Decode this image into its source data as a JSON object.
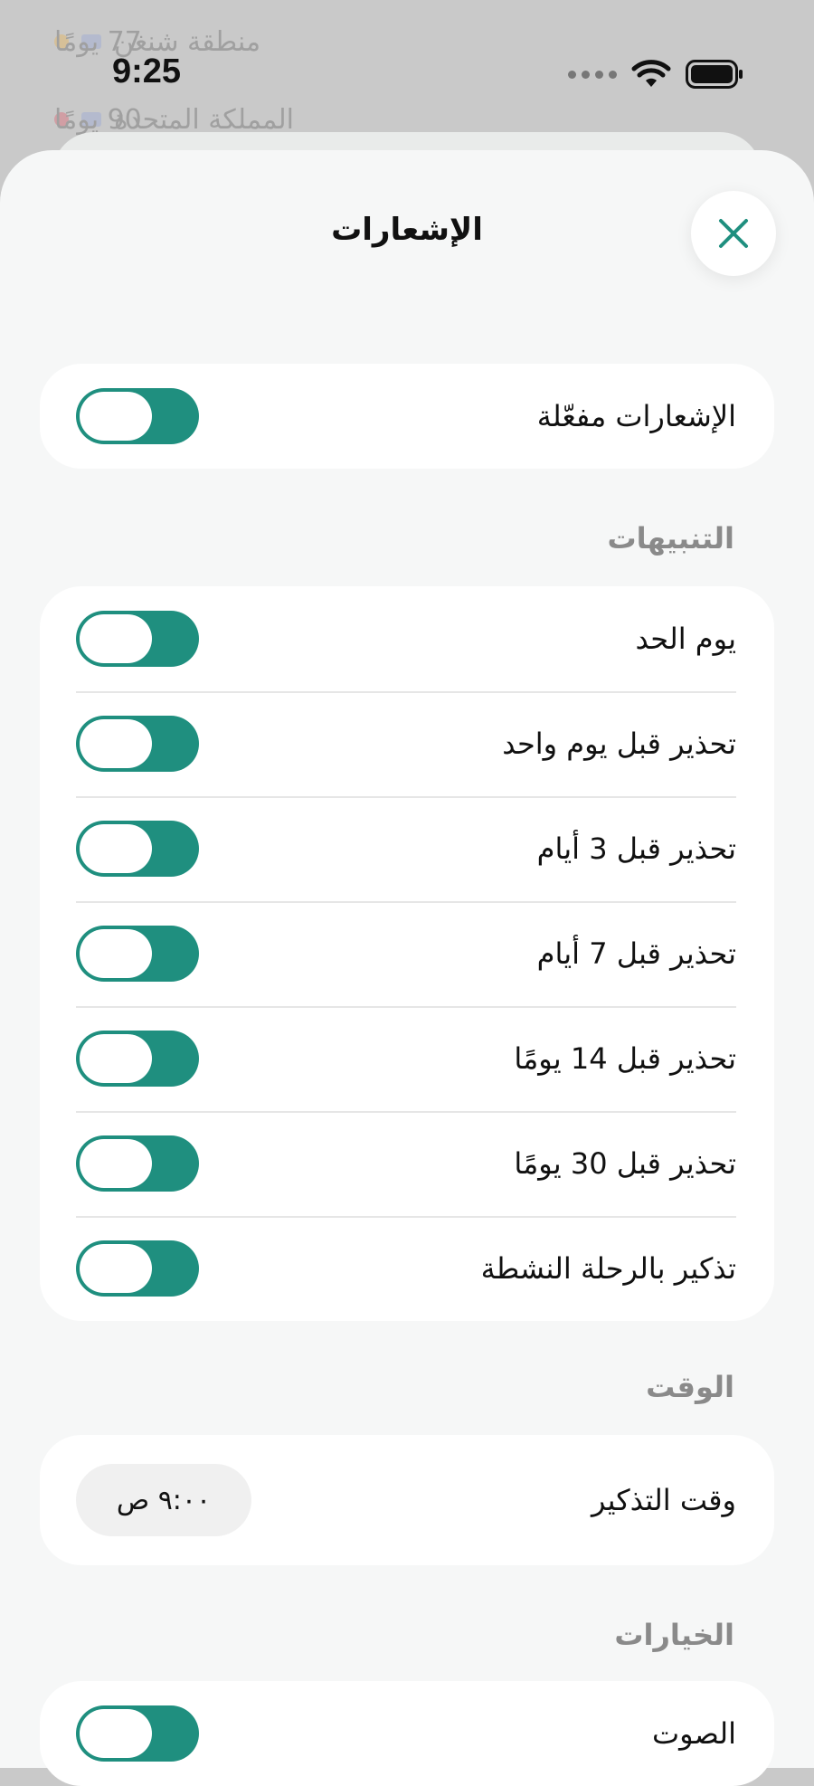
{
  "status_bar": {
    "time": "9:25"
  },
  "background": {
    "rows": [
      {
        "label": "منطقة شنغن",
        "value": "77 يومًا"
      },
      {
        "label": "المملكة المتحدة",
        "value": "90 يومًا"
      }
    ]
  },
  "sheet": {
    "title": "الإشعارات",
    "close_icon": "close-x-icon"
  },
  "master": {
    "label": "الإشعارات مفعّلة",
    "enabled": true
  },
  "alerts": {
    "header": "التنبيهات",
    "items": [
      {
        "label": "يوم الحد",
        "enabled": true
      },
      {
        "label": "تحذير قبل يوم واحد",
        "enabled": true
      },
      {
        "label": "تحذير قبل 3 أيام",
        "enabled": true
      },
      {
        "label": "تحذير قبل 7 أيام",
        "enabled": true
      },
      {
        "label": "تحذير قبل 14 يومًا",
        "enabled": true
      },
      {
        "label": "تحذير قبل 30 يومًا",
        "enabled": true
      },
      {
        "label": "تذكير بالرحلة النشطة",
        "enabled": true
      }
    ]
  },
  "time_section": {
    "header": "الوقت",
    "reminder_label": "وقت التذكير",
    "reminder_value": "٩:٠٠ ص"
  },
  "options": {
    "header": "الخيارات",
    "sound_label": "الصوت",
    "sound_enabled": true
  },
  "colors": {
    "accent": "#1f8f7f",
    "background": "#f6f7f7",
    "card": "#ffffff",
    "section_header": "#8a8a8a"
  }
}
